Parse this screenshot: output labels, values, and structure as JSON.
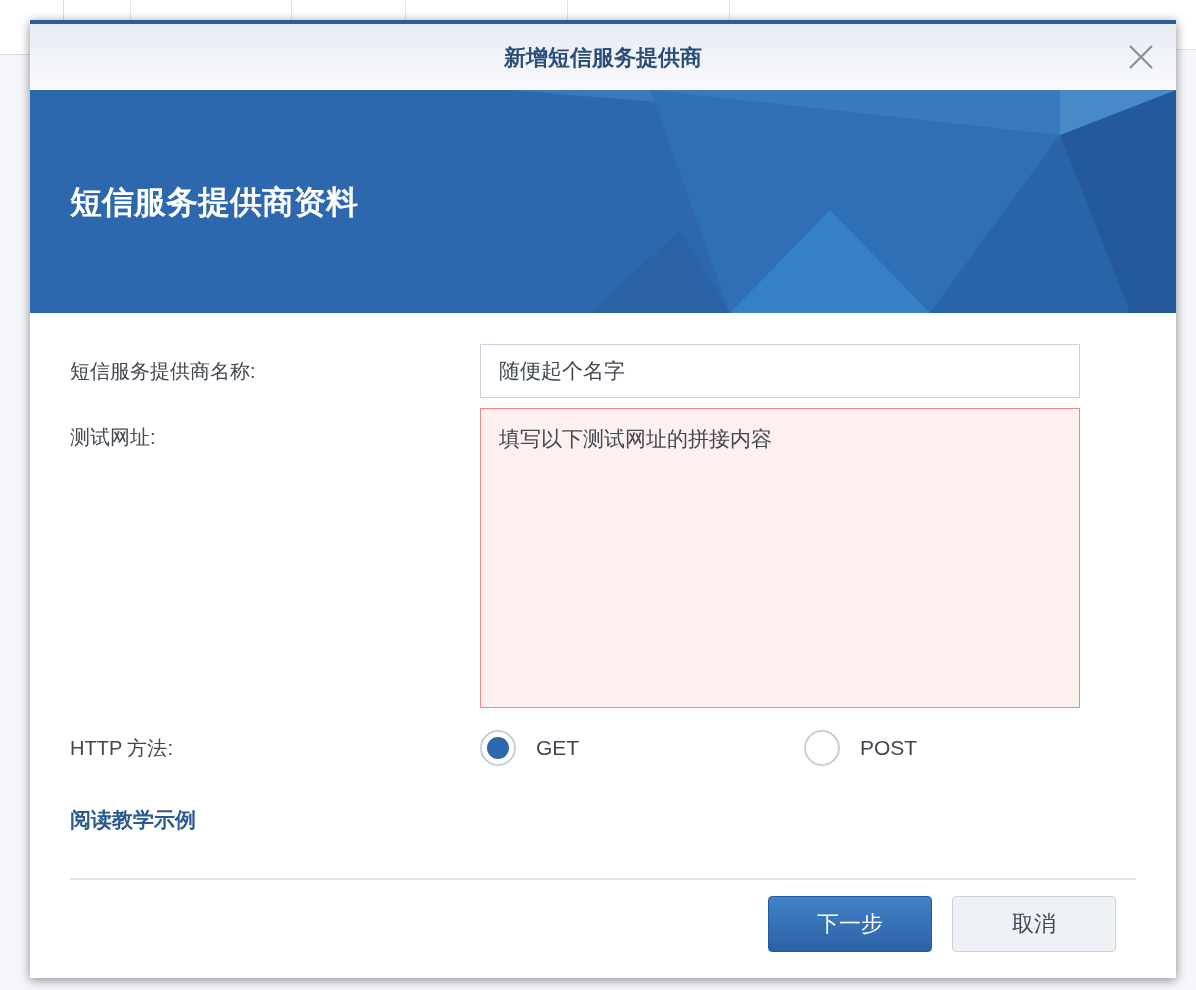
{
  "dialog": {
    "title": "新增短信服务提供商",
    "banner_title": "短信服务提供商资料",
    "name_field": {
      "label": "短信服务提供商名称:",
      "value": "随便起个名字"
    },
    "url_field": {
      "label": "测试网址:",
      "value": "填写以下测试网址的拼接内容",
      "error": true
    },
    "http_method": {
      "label": "HTTP 方法:",
      "options": [
        {
          "label": "GET",
          "selected": true
        },
        {
          "label": "POST",
          "selected": false
        }
      ]
    },
    "tutorial_link": "阅读教学示例",
    "buttons": [
      {
        "label": "下一步",
        "kind": "primary"
      },
      {
        "label": "取消",
        "kind": "secondary"
      }
    ]
  }
}
